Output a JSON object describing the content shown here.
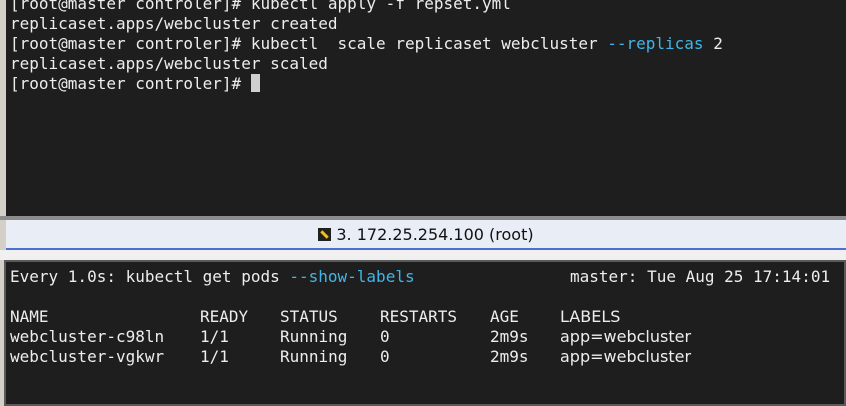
{
  "top_terminal": {
    "lines": [
      {
        "prompt": "[root@master controler]#",
        "command": " kubectl apply -f repset.yml"
      },
      {
        "output": "replicaset.apps/webcluster created"
      },
      {
        "prompt": "[root@master controler]#",
        "cmd_part1": " kubectl  scale replicaset webcluster ",
        "flag": "--replicas",
        "cmd_part2": " 2"
      },
      {
        "output": "replicaset.apps/webcluster scaled"
      },
      {
        "prompt": "[root@master controler]#"
      }
    ]
  },
  "tab": {
    "title": "3. 172.25.254.100 (root)",
    "icon": "ssh-key-icon"
  },
  "watch_terminal": {
    "header_prefix": "Every 1.0s: kubectl get pods ",
    "header_flag": "--show-labels",
    "header_right": "master: Tue Aug 25 17:14:01",
    "columns": [
      "NAME",
      "READY",
      "STATUS",
      "RESTARTS",
      "AGE",
      "LABELS"
    ],
    "rows": [
      [
        "webcluster-c98ln",
        "1/1",
        "Running",
        "0",
        "2m9s",
        "app=webcluster"
      ],
      [
        "webcluster-vgkwr",
        "1/1",
        "Running",
        "0",
        "2m9s",
        "app=webcluster"
      ]
    ]
  },
  "colors": {
    "terminal_bg": "#1e1e1e",
    "text": "#ededed",
    "flag_cyan": "#41b5e8",
    "tab_accent": "#4d6fd0"
  }
}
